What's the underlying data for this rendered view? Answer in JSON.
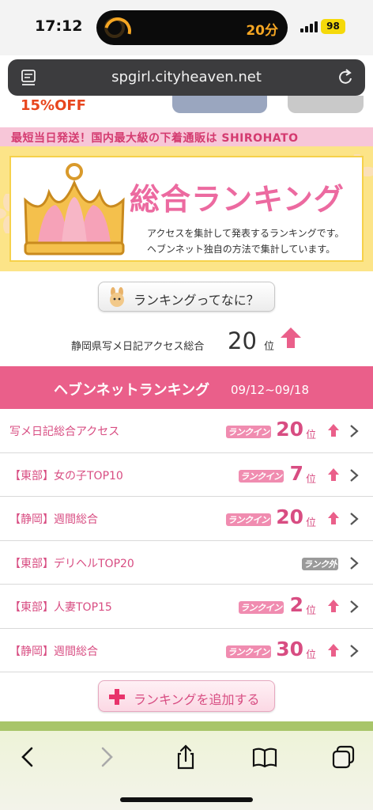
{
  "status_bar": {
    "time": "17:12",
    "island_timer": "20分",
    "battery": "98"
  },
  "browser": {
    "url": "spgirl.cityheaven.net"
  },
  "top_banner": {
    "sale_text": "15%OFF",
    "promo_text": "最短当日発送！国内最大級の下着通販は SHIROHATO"
  },
  "ranking_banner": {
    "title": "総合ランキング",
    "desc_line1": "アクセスを集計して発表するランキングです。",
    "desc_line2": "ヘブンネット独自の方法で集計しています。"
  },
  "what_is_ranking": {
    "label": "ランキングってなに？"
  },
  "summary": {
    "label": "静岡県写メ日記アクセス総合",
    "rank": "20",
    "unit": "位"
  },
  "heaven_net_ranking": {
    "title": "ヘブンネットランキング",
    "date_range": "09/12~09/18"
  },
  "rankings": [
    {
      "label": "写メ日記総合アクセス",
      "badge": "ランクイン",
      "rank": "20",
      "unit": "位",
      "ranked": true
    },
    {
      "label": "【東部】女の子TOP10",
      "badge": "ランクイン",
      "rank": "7",
      "unit": "位",
      "ranked": true
    },
    {
      "label": "【静岡】週間総合",
      "badge": "ランクイン",
      "rank": "20",
      "unit": "位",
      "ranked": true
    },
    {
      "label": "【東部】デリヘルTOP20",
      "badge": "ランク外",
      "rank": "",
      "unit": "",
      "ranked": false
    },
    {
      "label": "【東部】人妻TOP15",
      "badge": "ランクイン",
      "rank": "2",
      "unit": "位",
      "ranked": true
    },
    {
      "label": "【静岡】週間総合",
      "badge": "ランクイン",
      "rank": "30",
      "unit": "位",
      "ranked": true
    }
  ],
  "add_ranking": {
    "label": "ランキングを追加する"
  },
  "colors": {
    "accent_pink": "#ea5f8a",
    "rank_pink": "#d84d82",
    "banner_yellow": "#fce488"
  },
  "icons": {
    "back": "chevron-left-icon",
    "forward": "chevron-right-icon",
    "share": "share-icon",
    "bookmarks": "book-icon",
    "tabs": "tabs-icon"
  }
}
